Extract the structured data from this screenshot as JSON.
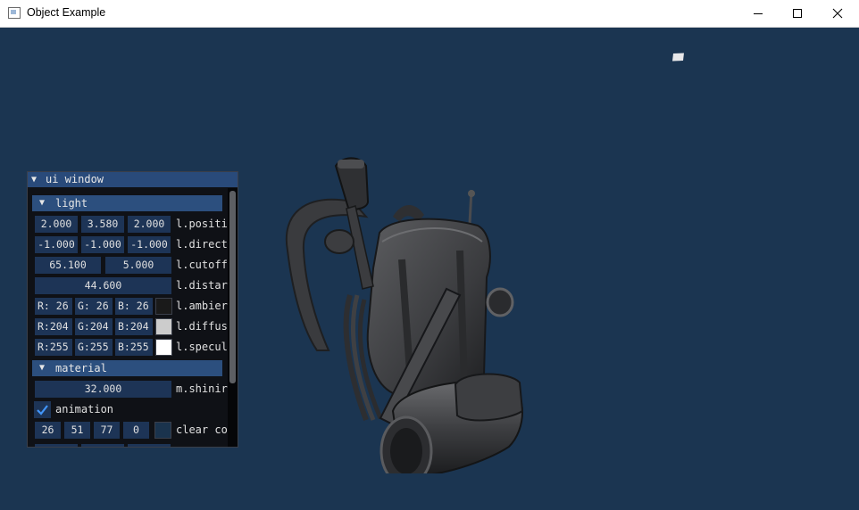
{
  "window": {
    "title": "Object Example",
    "minimize_icon": "minimize-icon",
    "maximize_icon": "maximize-icon",
    "close_icon": "close-icon"
  },
  "scene": {
    "model": "backpack-model",
    "light_marker": "light-cube"
  },
  "ui_window": {
    "title": "ui window",
    "light_header": "light",
    "position": {
      "x": "2.000",
      "y": "3.580",
      "z": "2.000",
      "label": "l.positi"
    },
    "direction": {
      "x": "-1.000",
      "y": "-1.000",
      "z": "-1.000",
      "label": "l.direct"
    },
    "cutoff": {
      "inner": "65.100",
      "outer": "5.000",
      "label": "l.cutoff"
    },
    "distance": {
      "value": "44.600",
      "label": "l.distar"
    },
    "ambient": {
      "r": "R: 26",
      "g": "G: 26",
      "b": "B: 26",
      "color": "#1a1a1a",
      "label": "l.ambier"
    },
    "diffuse": {
      "r": "R:204",
      "g": "G:204",
      "b": "B:204",
      "color": "#cccccc",
      "label": "l.diffus"
    },
    "specular": {
      "r": "R:255",
      "g": "G:255",
      "b": "B:255",
      "color": "#ffffff",
      "label": "l.specul"
    },
    "material_header": "material",
    "shininess": {
      "value": "32.000",
      "label": "m.shinir"
    },
    "animation": {
      "label": "animation",
      "checked": true
    },
    "clear_color": {
      "r": "26",
      "g": "51",
      "b": "77",
      "a": "0",
      "label": "clear co"
    }
  },
  "colors": {
    "background": "#1a3350",
    "field": "#1d3456",
    "header": "#2c4f7e",
    "title_bar": "#294a7a",
    "accent": "#4296fa"
  }
}
